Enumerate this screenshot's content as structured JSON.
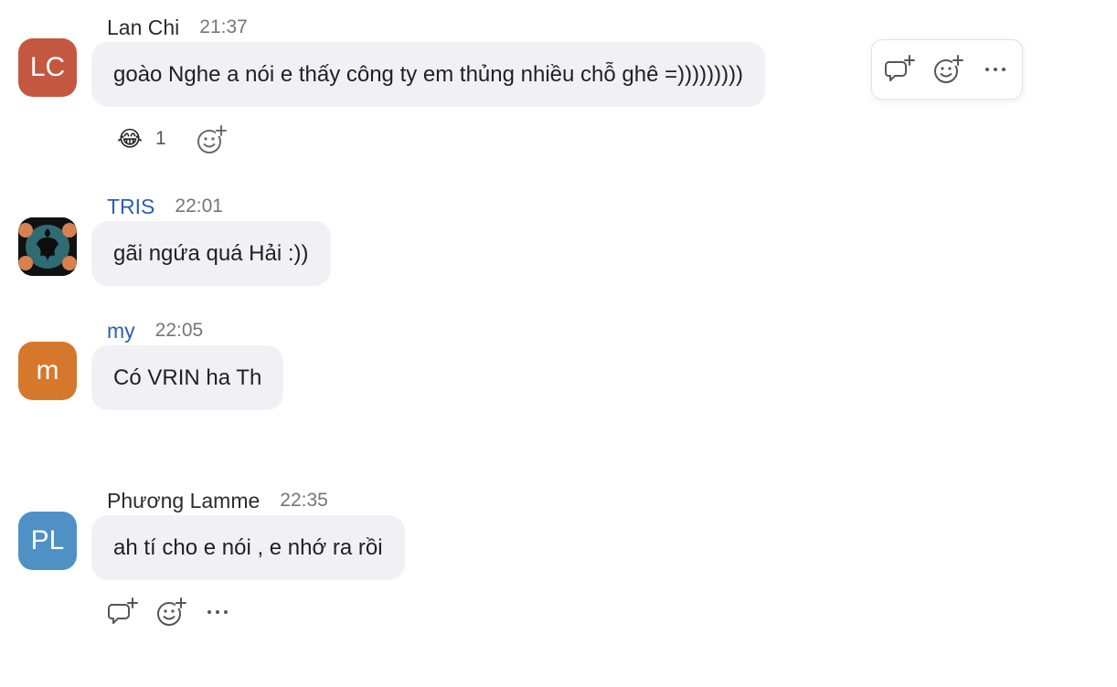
{
  "colors": {
    "lan_chi_avatar": "#c4573f",
    "my_avatar": "#d5782b",
    "phuong_avatar": "#4f91c4",
    "bubble": "#f1f1f5",
    "sender_link": "#2a5fb8"
  },
  "messages": [
    {
      "sender": "Lan Chi",
      "initials": "LC",
      "time": "21:37",
      "text": "goào Nghe a nói e thấy công ty em thủng nhiều chỗ ghê =)))))))))",
      "reactions": [
        {
          "emoji": "😂",
          "icon": "tears-of-joy-emoji",
          "count": "1"
        }
      ],
      "toolbar_icons": [
        "reply-in-thread-icon",
        "add-reaction-icon",
        "more-options-icon"
      ]
    },
    {
      "sender": "TRIS",
      "initials": "",
      "avatar_type": "image",
      "time": "22:01",
      "text": "gãi ngứa quá Hải :))"
    },
    {
      "sender": "my",
      "initials": "m",
      "time": "22:05",
      "text": "Có VRIN ha Th"
    },
    {
      "sender": "Phương Lamme",
      "initials": "PL",
      "time": "22:35",
      "text": "ah tí cho e nói , e nhớ ra rồi",
      "action_icons": [
        "reply-in-thread-icon",
        "add-reaction-icon",
        "more-options-icon"
      ]
    }
  ]
}
